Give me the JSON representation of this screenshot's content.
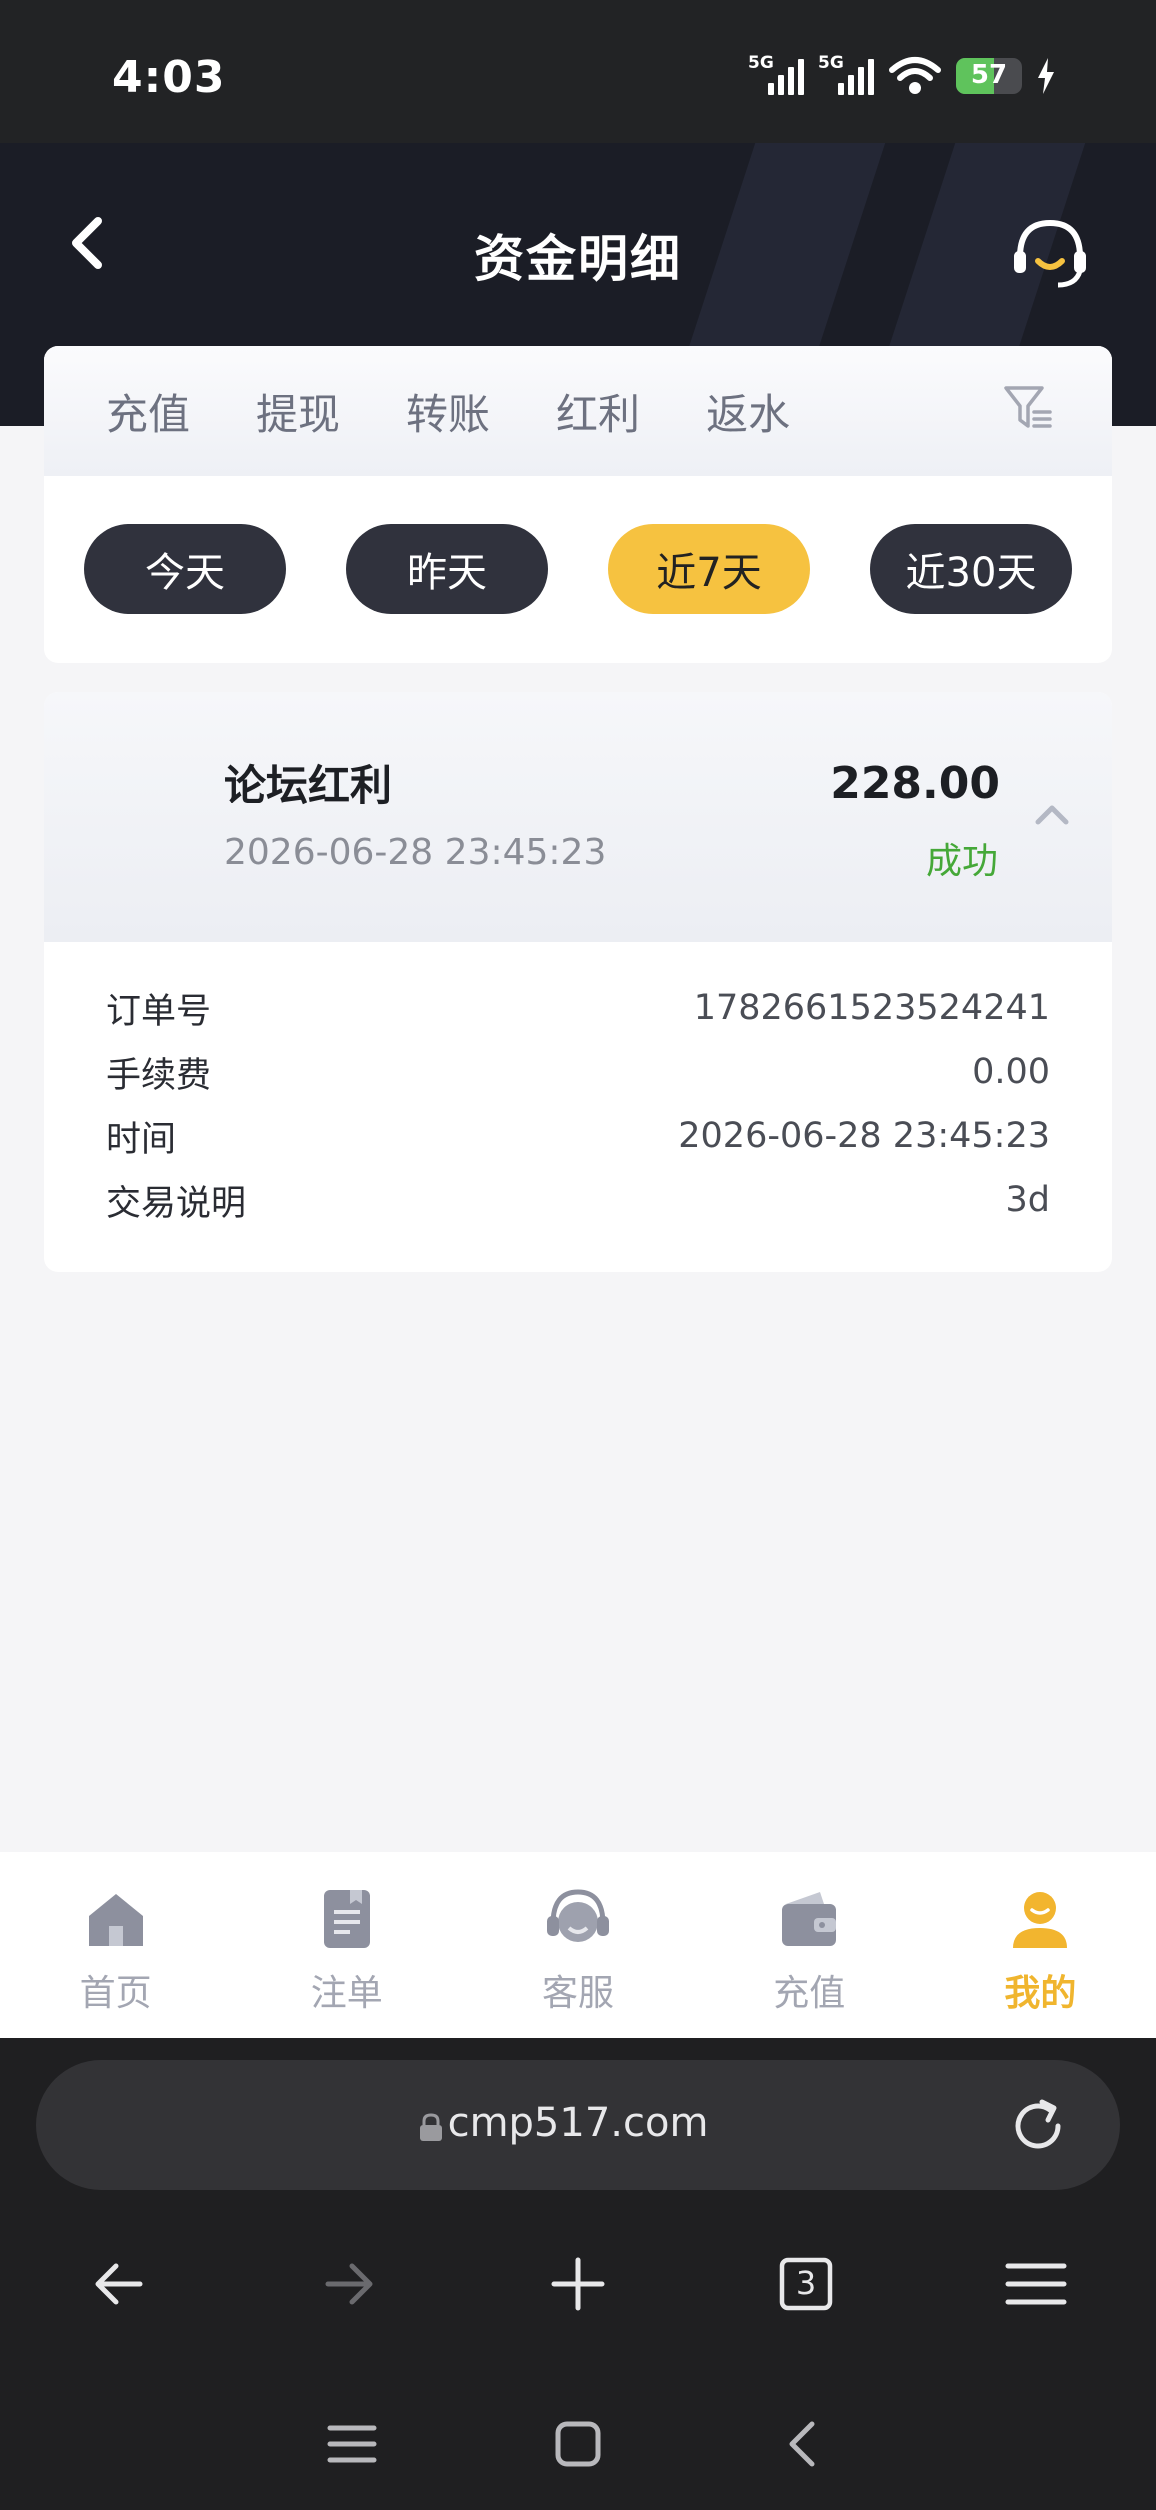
{
  "status_bar": {
    "time": "4:03",
    "net1": "5G",
    "net2": "5G",
    "battery": "57",
    "battery_level": 0.57
  },
  "header": {
    "title": "资金明细"
  },
  "tabs": [
    "充值",
    "提现",
    "转账",
    "红利",
    "返水"
  ],
  "periods": [
    {
      "label": "今天",
      "active": false
    },
    {
      "label": "昨天",
      "active": false
    },
    {
      "label": "近7天",
      "active": true
    },
    {
      "label": "近30天",
      "active": false
    }
  ],
  "record": {
    "title": "论坛红利",
    "datetime": "2026-06-28 23:45:23",
    "amount": "228.00",
    "status": "成功",
    "details": [
      {
        "label": "订单号",
        "value": "1782661523524241"
      },
      {
        "label": "手续费",
        "value": "0.00"
      },
      {
        "label": "时间",
        "value": "2026-06-28 23:45:23"
      },
      {
        "label": "交易说明",
        "value": "3d"
      }
    ]
  },
  "bottom_nav": [
    {
      "label": "首页",
      "icon": "home-icon",
      "active": false
    },
    {
      "label": "注单",
      "icon": "document-icon",
      "active": false
    },
    {
      "label": "客服",
      "icon": "headset-icon",
      "active": false
    },
    {
      "label": "充值",
      "icon": "wallet-icon",
      "active": false
    },
    {
      "label": "我的",
      "icon": "user-icon",
      "active": true
    }
  ],
  "browser": {
    "url": "cmp517.com",
    "tab_count": "3"
  },
  "colors": {
    "accent": "#f6c240",
    "success": "#45a838",
    "header_bg": "#1b1d26",
    "pill_bg": "#30323d"
  }
}
